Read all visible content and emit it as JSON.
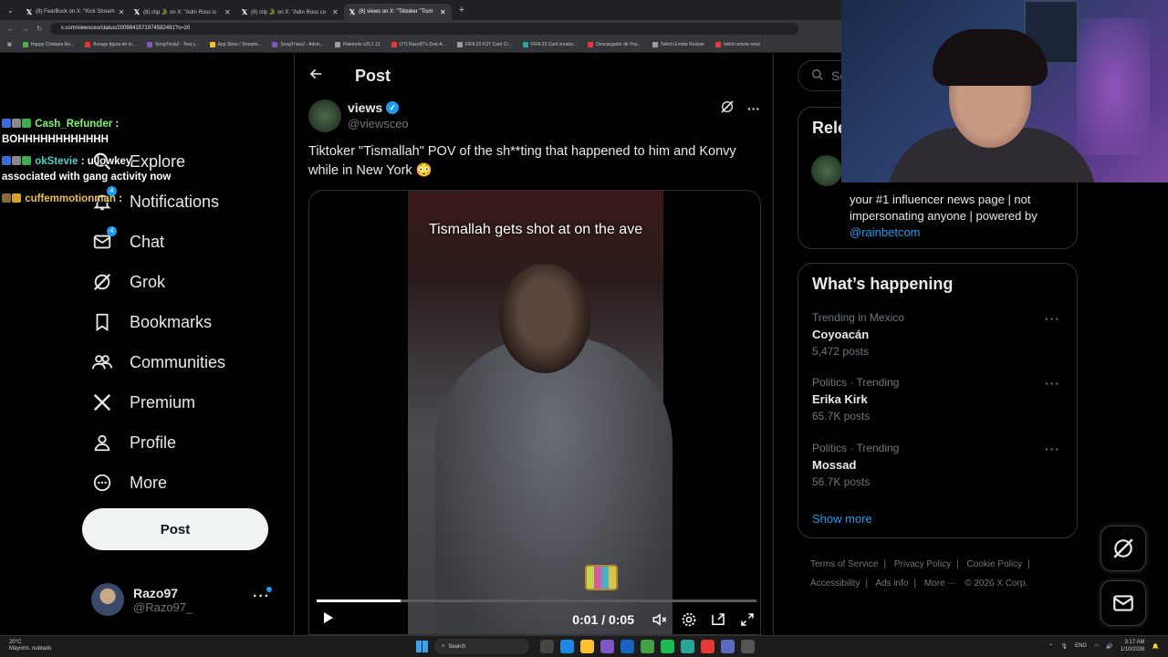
{
  "browser": {
    "tabs": [
      {
        "title": "(8) FearBuck on X: \"Kick Stream"
      },
      {
        "title": "(8) clip 🐊 on X: \"Adin Ross is"
      },
      {
        "title": "(8) clip 🐊 on X: \"Adin Ross co"
      },
      {
        "title": "(8) views on X: \"Tiktoker \"Tism"
      }
    ],
    "new_tab": "+",
    "url": "x.com/viewsceo/status/2009841571974582491?s=20",
    "bookmarks": [
      {
        "label": "Happy Cristiano Ro...",
        "color": "#4caf50"
      },
      {
        "label": "Burago figura de to...",
        "color": "#e53935"
      },
      {
        "label": "SongTrivia2 - Test y...",
        "color": "#7e57c2"
      },
      {
        "label": "App Store / Streami...",
        "color": "#fbc02d"
      },
      {
        "label": "SongTrivia2 - Advin...",
        "color": "#7e57c2"
      },
      {
        "label": "Paletools v25.1.11",
        "color": "#9e9e9e"
      },
      {
        "label": "(77) Razo97's Zest-A...",
        "color": "#e53935"
      },
      {
        "label": "FIFA 23 FUT Card Cr...",
        "color": "#9e9e9e"
      },
      {
        "label": "FIFA 23 Card creator...",
        "color": "#26a69a"
      },
      {
        "label": "Descargador de You...",
        "color": "#e53935"
      },
      {
        "label": "Twitch Emote Resizer",
        "color": "#9e9e9e"
      },
      {
        "label": "twitch emote resiz",
        "color": "#e53935"
      }
    ]
  },
  "chat": {
    "messages": [
      {
        "user": "Cash_Refunder",
        "sep": " :",
        "text": "BOHHHHHHHHHHHH",
        "color": "#7CFC6A"
      },
      {
        "user": "okStevie",
        "sep": " : u lowkey",
        "text": "associated with gang activity now",
        "color": "#4fd1c5"
      },
      {
        "user": "cuffemmotionman",
        "sep": " :",
        "text": "",
        "color": "#f0c24f"
      }
    ]
  },
  "nav": {
    "items": [
      {
        "label": "Explore",
        "icon": "search-icon"
      },
      {
        "label": "Notifications",
        "icon": "bell-icon",
        "badge": "4"
      },
      {
        "label": "Chat",
        "icon": "mail-icon",
        "badge": "4"
      },
      {
        "label": "Grok",
        "icon": "grok-icon"
      },
      {
        "label": "Bookmarks",
        "icon": "bookmark-icon"
      },
      {
        "label": "Communities",
        "icon": "people-icon"
      },
      {
        "label": "Premium",
        "icon": "x-logo-icon"
      },
      {
        "label": "Profile",
        "icon": "person-icon"
      },
      {
        "label": "More",
        "icon": "more-circle-icon"
      }
    ],
    "post_button": "Post",
    "account": {
      "name": "Razo97",
      "handle": "@Razo97_"
    }
  },
  "post": {
    "header_title": "Post",
    "author_name": "views",
    "author_handle": "@viewsceo",
    "text": "Tiktoker \"Tismallah\" POV of the sh**ting that happened to him and Konvy while in New York 😳",
    "video_caption": "Tismallah gets shot at on the ave",
    "video_time": "0:01 / 0:05",
    "progress_fraction": 0.19
  },
  "search": {
    "placeholder": "Sea"
  },
  "relevant": {
    "title": "Rele",
    "bio": "your #1 influencer news page | not impersonating anyone | powered by",
    "bio_link": "@rainbetcom"
  },
  "happening": {
    "title": "What’s happening",
    "trends": [
      {
        "context": "Trending in Mexico",
        "name": "Coyoacán",
        "posts": "5,472 posts"
      },
      {
        "context": "Politics · Trending",
        "name": "Erika Kirk",
        "posts": "65.7K posts"
      },
      {
        "context": "Politics · Trending",
        "name": "Mossad",
        "posts": "56.7K posts"
      }
    ],
    "show_more": "Show more"
  },
  "footer": {
    "links": [
      "Terms of Service",
      "|",
      "Privacy Policy",
      "|",
      "Cookie Policy",
      "|",
      "Accessibility",
      "|",
      "Ads info",
      "|",
      "More ···",
      "© 2026 X Corp."
    ]
  },
  "taskbar": {
    "weather_temp": "20°C",
    "weather_desc": "Mayorm. nublado",
    "search": "Search",
    "lang": "ENG",
    "time": "3:17 AM",
    "date": "1/10/2026"
  }
}
